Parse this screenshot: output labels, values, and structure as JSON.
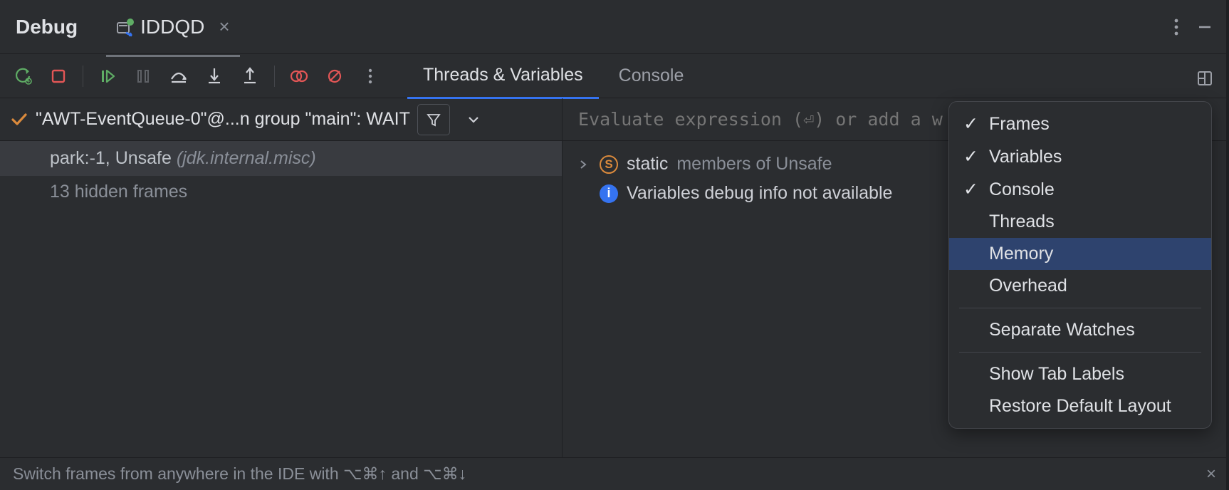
{
  "tool_window": {
    "label": "Debug"
  },
  "run_tab": {
    "name": "IDDQD"
  },
  "toolbar_tabs": {
    "threads_vars": "Threads & Variables",
    "console": "Console"
  },
  "thread": {
    "text": "\"AWT-EventQueue-0\"@...n group \"main\": WAIT"
  },
  "frames": {
    "selected": {
      "method": "park:-1, Unsafe",
      "location": "(jdk.internal.misc)"
    },
    "hidden": "13 hidden frames"
  },
  "eval": {
    "placeholder": "Evaluate expression (⏎) or add a w"
  },
  "variables": {
    "static_row": {
      "kind": "static",
      "rest": "members of Unsafe"
    },
    "info_row": "Variables debug info not available"
  },
  "popup": {
    "items": [
      {
        "label": "Frames",
        "checked": true
      },
      {
        "label": "Variables",
        "checked": true
      },
      {
        "label": "Console",
        "checked": true
      },
      {
        "label": "Threads",
        "checked": false
      },
      {
        "label": "Memory",
        "checked": false,
        "highlight": true
      },
      {
        "label": "Overhead",
        "checked": false
      }
    ],
    "separate_watches": "Separate Watches",
    "show_tab_labels": "Show Tab Labels",
    "restore": "Restore Default Layout"
  },
  "status": {
    "text": "Switch frames from anywhere in the IDE with ⌥⌘↑ and ⌥⌘↓"
  }
}
